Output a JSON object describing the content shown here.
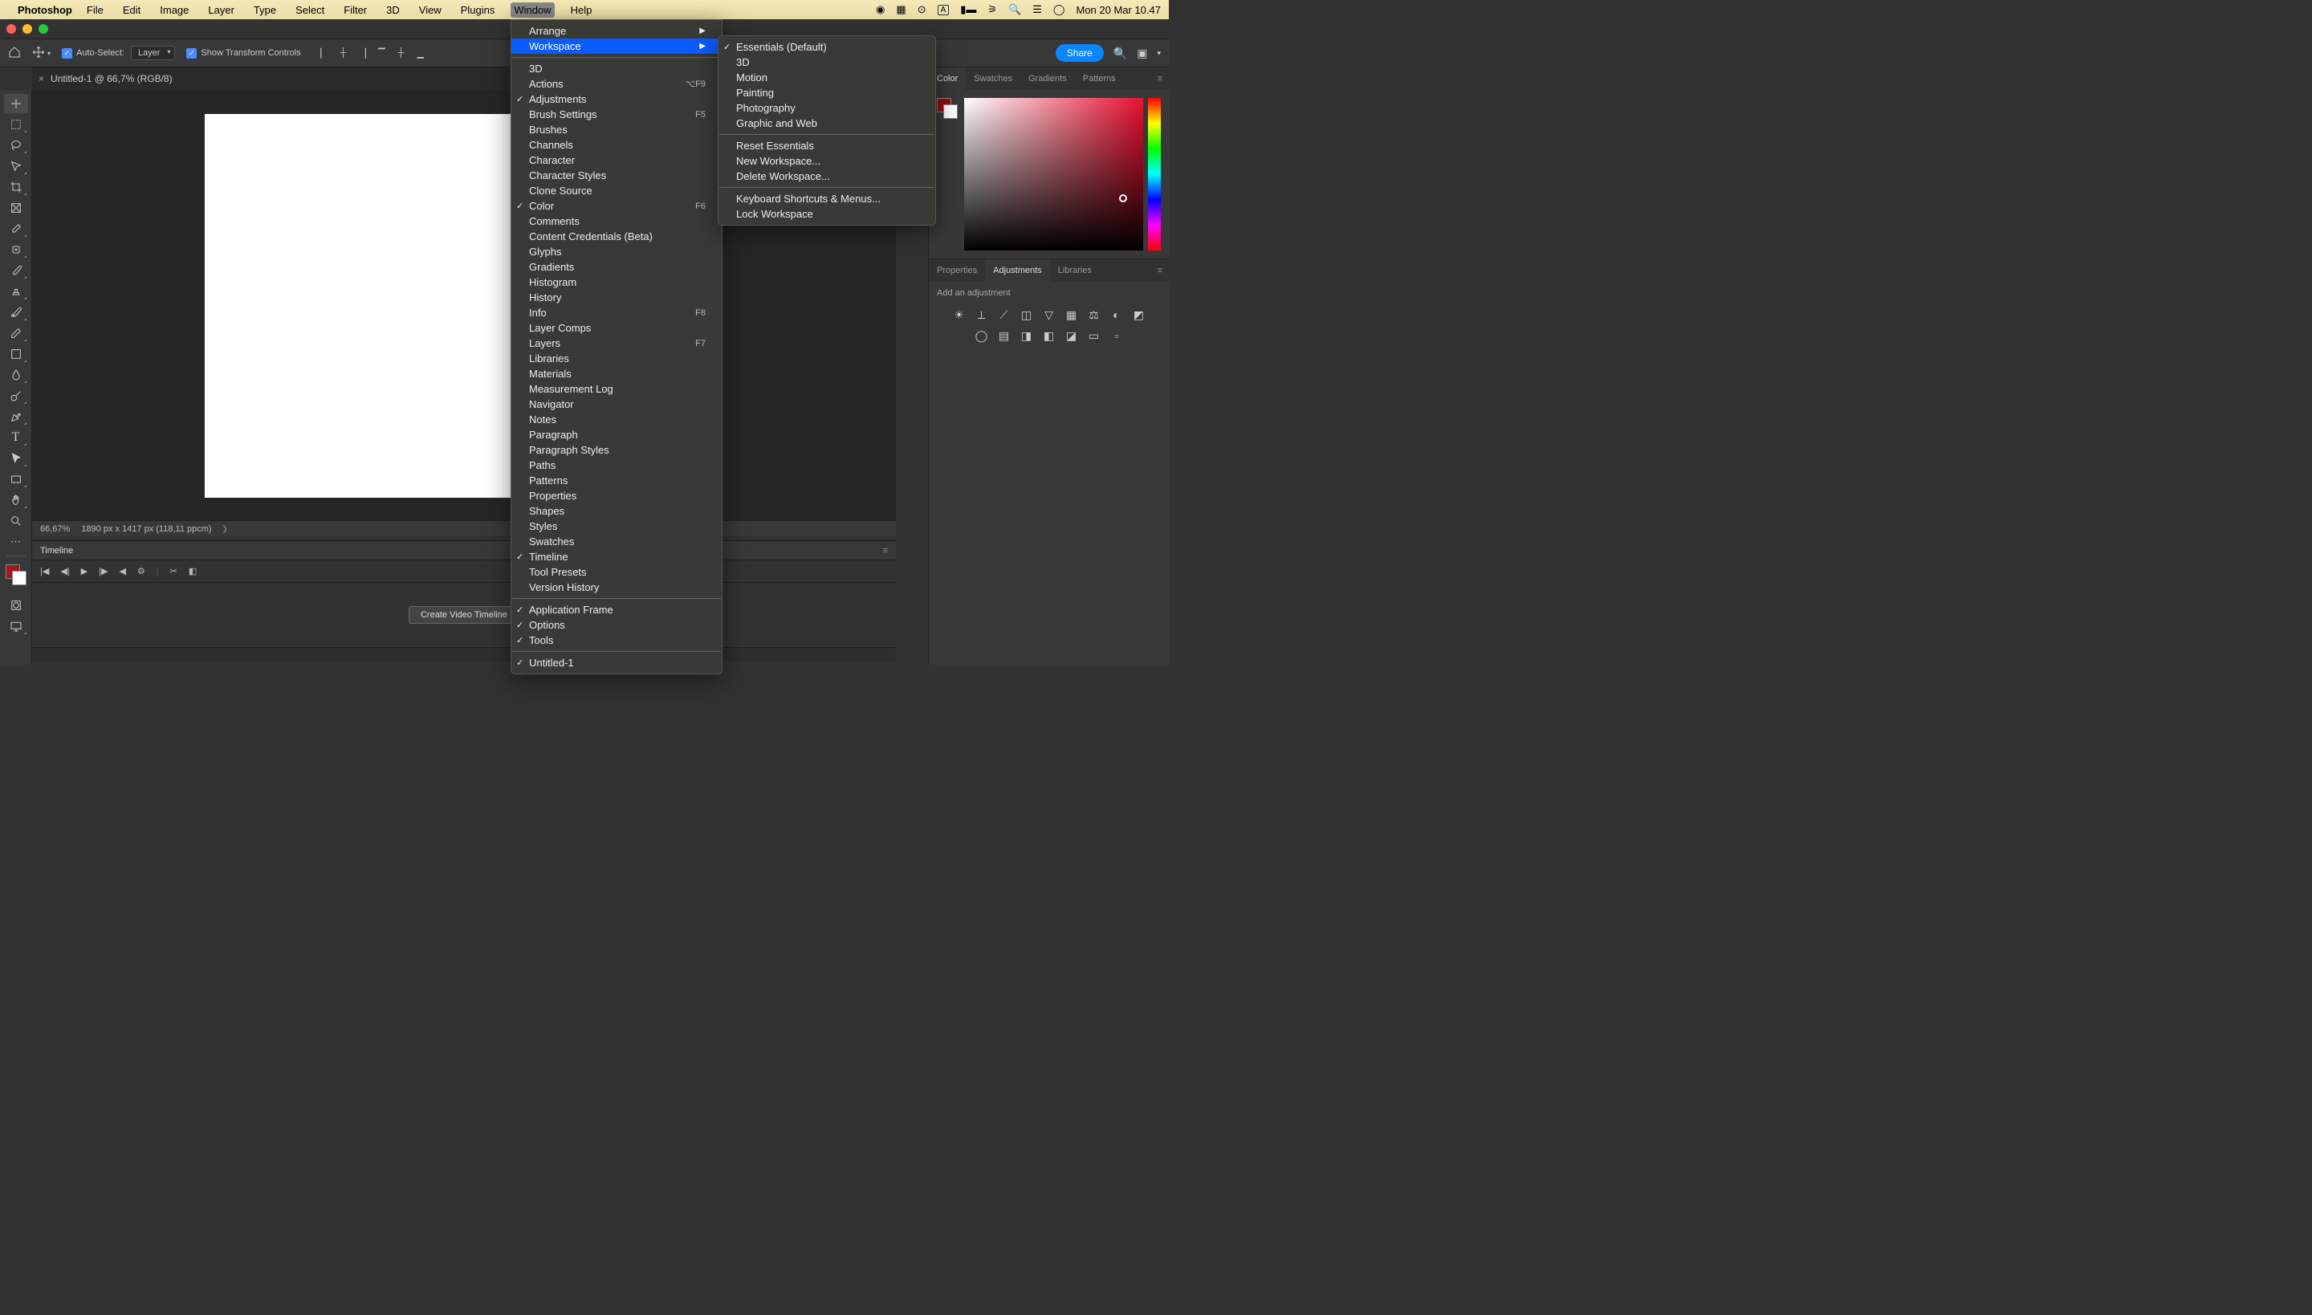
{
  "menubar": {
    "app_name": "Photoshop",
    "items": [
      "File",
      "Edit",
      "Image",
      "Layer",
      "Type",
      "Select",
      "Filter",
      "3D",
      "View",
      "Plugins",
      "Window",
      "Help"
    ],
    "date_time": "Mon 20 Mar  10.47"
  },
  "options_bar": {
    "auto_select_label": "Auto-Select:",
    "auto_select_target": "Layer",
    "transform_label": "Show Transform Controls",
    "share": "Share"
  },
  "tab": {
    "title": "Untitled-1 @ 66,7% (RGB/8)"
  },
  "status": {
    "zoom": "66,67%",
    "dims": "1890 px x 1417 px (118,11 ppcm)"
  },
  "timeline": {
    "title": "Timeline",
    "create_button": "Create Video Timeline"
  },
  "right_panels": {
    "color_tabs": [
      "Color",
      "Swatches",
      "Gradients",
      "Patterns"
    ],
    "prop_tabs": [
      "Properties",
      "Adjustments",
      "Libraries"
    ],
    "add_adjustment": "Add an adjustment"
  },
  "window_menu": {
    "arrange": "Arrange",
    "workspace": "Workspace",
    "items": [
      {
        "label": "3D"
      },
      {
        "label": "Actions",
        "shortcut": "⌥F9"
      },
      {
        "label": "Adjustments",
        "checked": true
      },
      {
        "label": "Brush Settings",
        "shortcut": "F5"
      },
      {
        "label": "Brushes"
      },
      {
        "label": "Channels"
      },
      {
        "label": "Character"
      },
      {
        "label": "Character Styles"
      },
      {
        "label": "Clone Source"
      },
      {
        "label": "Color",
        "shortcut": "F6",
        "checked": true
      },
      {
        "label": "Comments"
      },
      {
        "label": "Content Credentials (Beta)"
      },
      {
        "label": "Glyphs"
      },
      {
        "label": "Gradients"
      },
      {
        "label": "Histogram"
      },
      {
        "label": "History"
      },
      {
        "label": "Info",
        "shortcut": "F8"
      },
      {
        "label": "Layer Comps"
      },
      {
        "label": "Layers",
        "shortcut": "F7"
      },
      {
        "label": "Libraries"
      },
      {
        "label": "Materials"
      },
      {
        "label": "Measurement Log"
      },
      {
        "label": "Navigator"
      },
      {
        "label": "Notes"
      },
      {
        "label": "Paragraph"
      },
      {
        "label": "Paragraph Styles"
      },
      {
        "label": "Paths"
      },
      {
        "label": "Patterns"
      },
      {
        "label": "Properties"
      },
      {
        "label": "Shapes"
      },
      {
        "label": "Styles"
      },
      {
        "label": "Swatches"
      },
      {
        "label": "Timeline",
        "checked": true
      },
      {
        "label": "Tool Presets"
      },
      {
        "label": "Version History"
      }
    ],
    "app_frame": "Application Frame",
    "options": "Options",
    "tools": "Tools",
    "doc": "Untitled-1"
  },
  "workspace_submenu": {
    "presets": [
      {
        "label": "Essentials (Default)",
        "checked": true
      },
      {
        "label": "3D"
      },
      {
        "label": "Motion"
      },
      {
        "label": "Painting"
      },
      {
        "label": "Photography"
      },
      {
        "label": "Graphic and Web"
      }
    ],
    "reset": "Reset Essentials",
    "new": "New Workspace...",
    "delete": "Delete Workspace...",
    "shortcuts": "Keyboard Shortcuts & Menus...",
    "lock": "Lock Workspace"
  }
}
